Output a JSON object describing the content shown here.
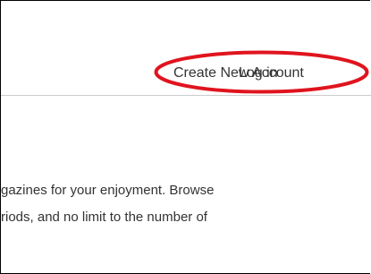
{
  "header": {
    "login_label": "Log in",
    "create_account_label": "Create New Account",
    "highlight_color": "#e0141e"
  },
  "content": {
    "line1": "gazines for your enjoyment. Browse",
    "line2": "riods, and no limit to the number of"
  }
}
